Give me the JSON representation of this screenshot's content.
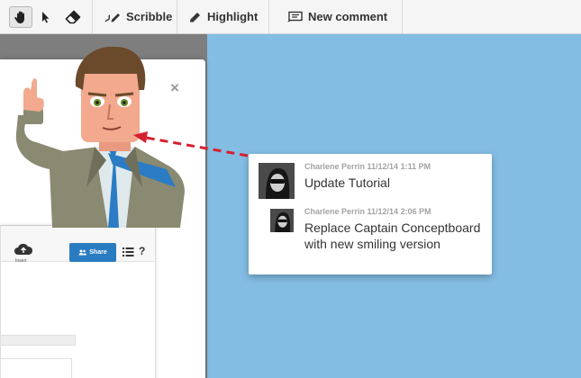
{
  "toolbar": {
    "scribble_label": "Scribble",
    "highlight_label": "Highlight",
    "new_comment_label": "New comment"
  },
  "tutorial": {
    "close_label": "×",
    "mini_app": {
      "insert_label": "Insert",
      "share_label": "Share",
      "help_label": "?"
    }
  },
  "comments": [
    {
      "author": "Charlene Perrin",
      "date": "11/12/14",
      "time": "1:11 PM",
      "meta": "Charlene Perrin 11/12/14 1:11 PM",
      "text": "Update Tutorial"
    },
    {
      "author": "Charlene Perrin",
      "date": "11/12/14",
      "time": "2:06 PM",
      "meta": "Charlene Perrin 11/12/14 2:06 PM",
      "text": "Replace Captain Conceptboard with new smiling version"
    }
  ],
  "colors": {
    "board_background": "#84bde3",
    "connector_arrow": "#d62030",
    "share_button": "#2a7cc0"
  }
}
